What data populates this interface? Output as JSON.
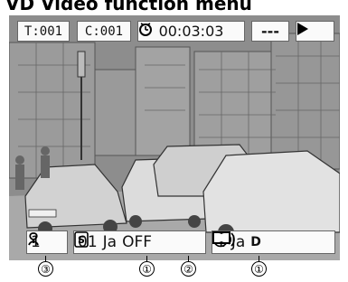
{
  "heading": "VD Video function menu",
  "top_bar": {
    "title_number": "T:001",
    "chapter_number": "C:001",
    "elapsed_time": "00:03:03",
    "dash_display": "---",
    "play_icon": "play-icon"
  },
  "bottom_bar": {
    "angle_icon": "angle-icon",
    "angle_number": "1",
    "subtitle_icon": "subtitle-icon",
    "subtitle_number": "01",
    "subtitle_language": "Ja",
    "subtitle_state": "OFF",
    "audio_icon": "audio-icon",
    "audio_number": "1",
    "audio_language": "Ja",
    "audio_format": "D"
  },
  "callouts": [
    "③",
    "①",
    "②",
    "①"
  ]
}
